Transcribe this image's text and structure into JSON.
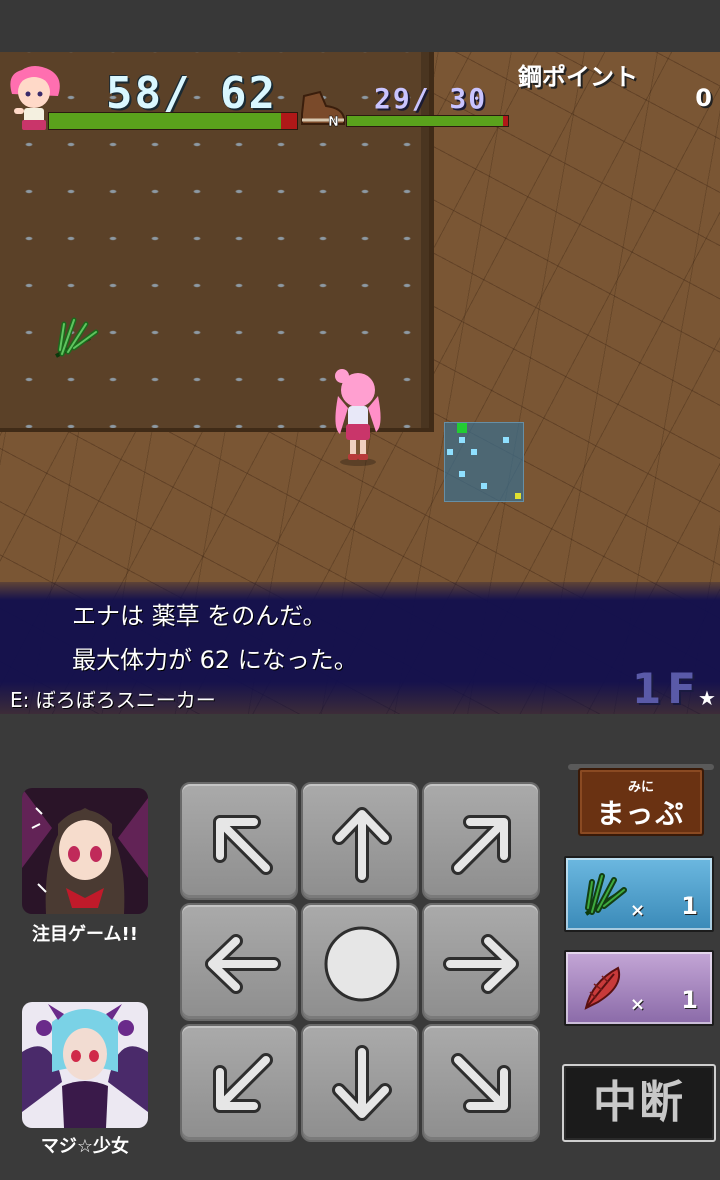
{
  "hud": {
    "hp_text": "58/ 62",
    "hp_current": 58,
    "hp_max": 62,
    "sp_text": "29/ 30",
    "sp_current": 29,
    "sp_max": 30,
    "boot_letter": "N",
    "points_label": "鋼ポイント",
    "points_value": "0"
  },
  "messages": {
    "line1": "エナは 薬草 をのんだ。",
    "line2": "最大体力が 62 になった。",
    "equipment": "E: ぼろぼろスニーカー",
    "floor": "1F",
    "floor_star": "★"
  },
  "side_ads": {
    "ad1_label": "注目ゲーム!!",
    "ad2_label": "マジ☆少女"
  },
  "controls": {
    "minimap_small": "みに",
    "minimap_big": "まっぷ",
    "herb_x": "×",
    "herb_count": "1",
    "feather_x": "×",
    "feather_count": "1",
    "suspend": "中断"
  },
  "icons": {
    "up-left": "arrow-up-left-icon",
    "up": "arrow-up-icon",
    "up-right": "arrow-up-right-icon",
    "left": "arrow-left-icon",
    "center": "circle-wait-icon",
    "right": "arrow-right-icon",
    "down-left": "arrow-down-left-icon",
    "down": "arrow-down-icon",
    "down-right": "arrow-down-right-icon"
  },
  "colors": {
    "hp_fill": "#5aa21c",
    "bar_empty": "#b01818",
    "message_bg": "#100e4e",
    "herb_slot": "#3a8ab8",
    "feather_slot": "#8a6aa8"
  }
}
